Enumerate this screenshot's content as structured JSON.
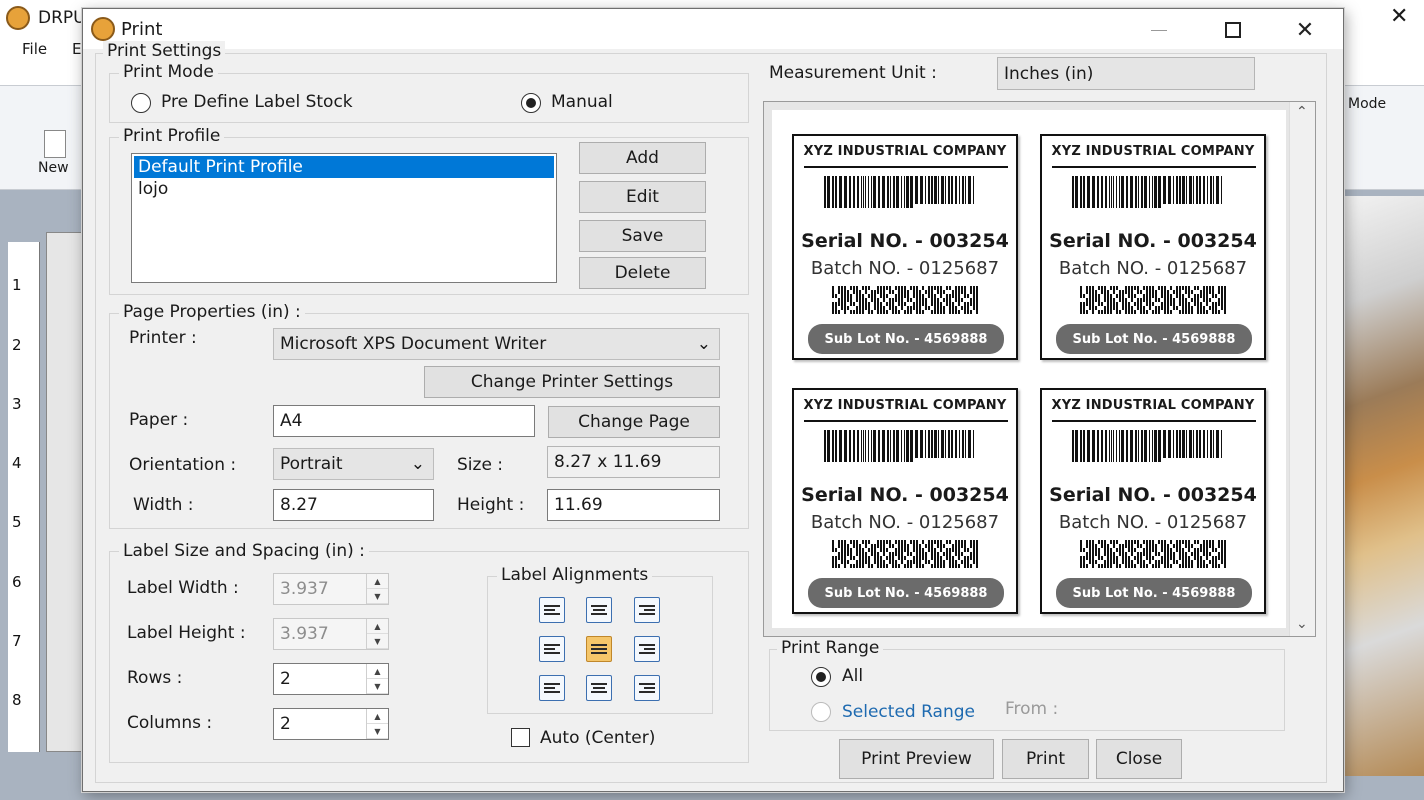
{
  "bg_app": {
    "title": "DRPU",
    "menu": [
      "File",
      "E"
    ],
    "ribbon_new": "New",
    "ribbon_mode": "Mode",
    "ruler_numbers": [
      "1",
      "2",
      "3",
      "4",
      "5",
      "6",
      "7",
      "8"
    ]
  },
  "dialog": {
    "title": "Print",
    "print_settings": "Print Settings",
    "print_mode": {
      "legend": "Print Mode",
      "option_predefine": "Pre Define Label Stock",
      "option_manual": "Manual",
      "selected": "Manual"
    },
    "print_profile": {
      "legend": "Print Profile",
      "items": [
        "Default Print Profile",
        "lojo"
      ],
      "selected": "Default Print Profile",
      "add": "Add",
      "edit": "Edit",
      "save": "Save",
      "delete": "Delete"
    },
    "page_properties": {
      "legend": "Page Properties (in) :",
      "printer_label": "Printer :",
      "printer_value": "Microsoft XPS Document Writer",
      "change_printer": "Change Printer Settings",
      "paper_label": "Paper :",
      "paper_value": "A4",
      "change_page": "Change Page",
      "orientation_label": "Orientation :",
      "orientation_value": "Portrait",
      "size_label": "Size :",
      "size_value": "8.27 x 11.69",
      "width_label": "Width :",
      "width_value": "8.27",
      "height_label": "Height :",
      "height_value": "11.69"
    },
    "label_size": {
      "legend": "Label Size and Spacing (in) :",
      "label_width_label": "Label Width :",
      "label_width_value": "3.937",
      "label_height_label": "Label Height :",
      "label_height_value": "3.937",
      "rows_label": "Rows :",
      "rows_value": "2",
      "columns_label": "Columns :",
      "columns_value": "2",
      "alignments_legend": "Label Alignments",
      "selected_alignment": "middle-center",
      "auto_center": "Auto (Center)",
      "auto_center_checked": false
    },
    "measurement": {
      "label": "Measurement Unit :",
      "value": "Inches (in)"
    },
    "preview": {
      "labels": [
        {
          "company": "XYZ INDUSTRIAL COMPANY",
          "serial": "Serial NO. - 003254",
          "batch": "Batch NO. - 0125687",
          "sublot": "Sub Lot No. - 4569888"
        },
        {
          "company": "XYZ INDUSTRIAL COMPANY",
          "serial": "Serial NO. - 003254",
          "batch": "Batch NO. - 0125687",
          "sublot": "Sub Lot No. - 4569888"
        },
        {
          "company": "XYZ INDUSTRIAL COMPANY",
          "serial": "Serial NO. - 003254",
          "batch": "Batch NO. - 0125687",
          "sublot": "Sub Lot No. - 4569888"
        },
        {
          "company": "XYZ INDUSTRIAL COMPANY",
          "serial": "Serial NO. - 003254",
          "batch": "Batch NO. - 0125687",
          "sublot": "Sub Lot No. - 4569888"
        }
      ]
    },
    "print_range": {
      "legend": "Print Range",
      "all": "All",
      "selected_range": "Selected Range",
      "from": "From :",
      "selected": "All"
    },
    "buttons": {
      "print_preview": "Print Preview",
      "print": "Print",
      "close": "Close"
    }
  },
  "colors": {
    "selection": "#0078d7",
    "link_text": "#1e6ab0",
    "active_alignment": "#f5c66a"
  }
}
